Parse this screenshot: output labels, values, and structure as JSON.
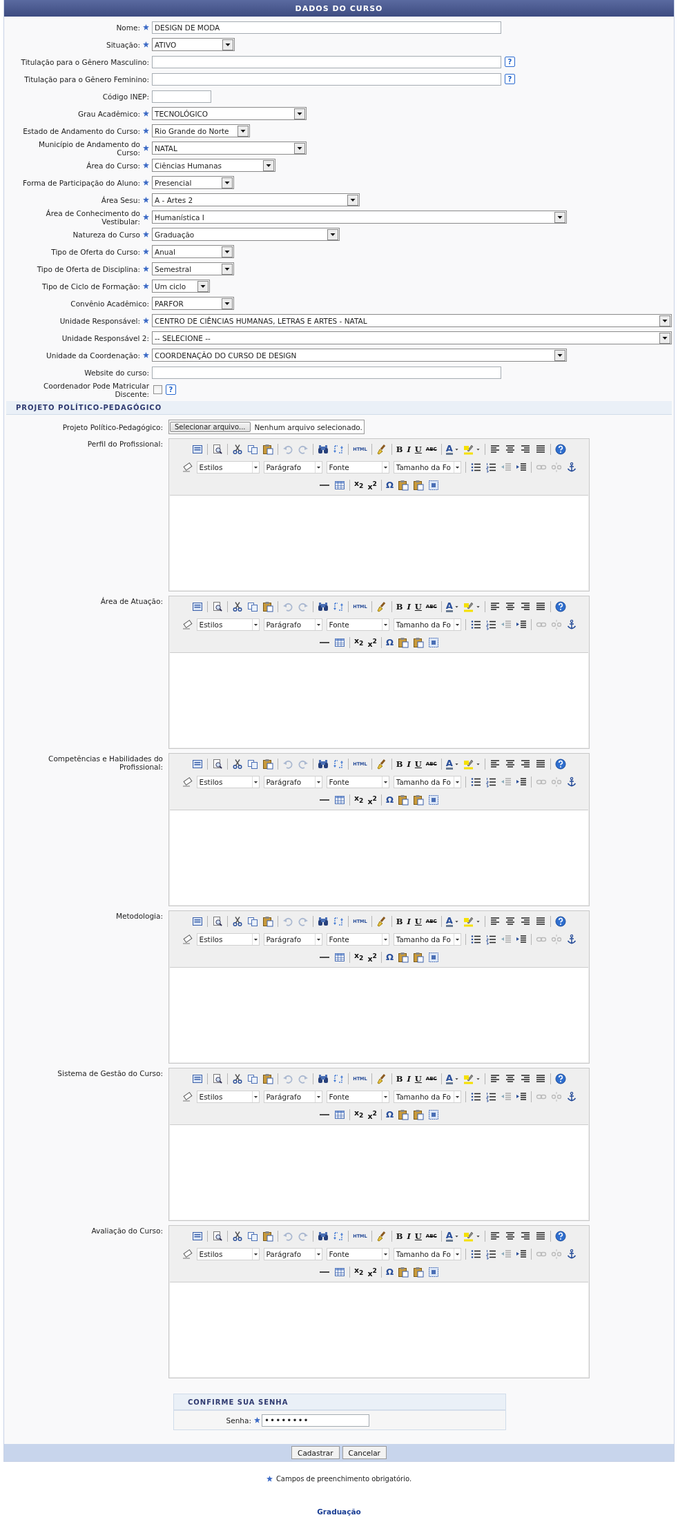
{
  "title": "DADOS DO CURSO",
  "fields": [
    {
      "label": "Nome:",
      "required": true,
      "kind": "text",
      "value": "DESIGN DE MODA"
    },
    {
      "label": "Situação:",
      "required": true,
      "kind": "select",
      "value": "ATIVO"
    },
    {
      "label": "Titulação para o Gênero Masculino:",
      "required": false,
      "kind": "text",
      "help": "?"
    },
    {
      "label": "Titulação para o Gênero Feminino:",
      "required": false,
      "kind": "text",
      "help": "?"
    },
    {
      "label": "Código INEP:",
      "required": false,
      "kind": "text"
    },
    {
      "label": "Grau Acadêmico:",
      "required": true,
      "kind": "select",
      "value": "TECNOLÓGICO"
    },
    {
      "label": "Estado de Andamento do Curso:",
      "required": true,
      "kind": "select",
      "value": "Rio Grande do Norte"
    },
    {
      "label": "Município de Andamento do Curso:",
      "required": true,
      "kind": "select",
      "value": "NATAL"
    },
    {
      "label": "Área do Curso:",
      "required": true,
      "kind": "select",
      "value": "Ciências Humanas"
    },
    {
      "label": "Forma de Participação do Aluno:",
      "required": true,
      "kind": "select",
      "value": "Presencial"
    },
    {
      "label": "Área Sesu:",
      "required": true,
      "kind": "select",
      "value": "A - Artes 2"
    },
    {
      "label": "Área de Conhecimento do Vestibular:",
      "required": true,
      "kind": "select",
      "value": "Humanística I"
    },
    {
      "label": "Natureza do Curso",
      "required": true,
      "kind": "select",
      "value": "Graduação"
    },
    {
      "label": "Tipo de Oferta do Curso:",
      "required": true,
      "kind": "select",
      "value": "Anual"
    },
    {
      "label": "Tipo de Oferta de Disciplina:",
      "required": true,
      "kind": "select",
      "value": "Semestral"
    },
    {
      "label": "Tipo de Ciclo de Formação:",
      "required": true,
      "kind": "select",
      "value": "Um ciclo"
    },
    {
      "label": "Convênio Acadêmico:",
      "required": false,
      "kind": "select",
      "value": "PARFOR"
    },
    {
      "label": "Unidade Responsável:",
      "required": true,
      "kind": "select",
      "value": "CENTRO DE CIÊNCIAS HUMANAS, LETRAS E ARTES - NATAL"
    },
    {
      "label": "Unidade Responsável 2:",
      "required": false,
      "kind": "select",
      "value": "-- SELECIONE --"
    },
    {
      "label": "Unidade da Coordenação:",
      "required": true,
      "kind": "select",
      "value": "COORDENAÇÃO DO CURSO DE DESIGN"
    },
    {
      "label": "Website do curso:",
      "required": false,
      "kind": "text"
    },
    {
      "label": "Coordenador Pode Matricular Discente:",
      "required": false,
      "kind": "checkbox",
      "checked": false,
      "help": "?"
    }
  ],
  "section": "PROJETO POLÍTICO-PEDAGÓGICO",
  "file_field": {
    "label": "Projeto Político-Pedagógico:",
    "button": "Selecionar arquivo...",
    "status": "Nenhum arquivo selecionado."
  },
  "editors": [
    {
      "label": "Perfil do Profissional:",
      "combos": [
        "Estilos",
        "Parágrafo",
        "Fonte",
        "Tamanho da Fo"
      ],
      "text_buttons": [
        "HTML",
        "B",
        "I",
        "U",
        "ABC",
        "A",
        "x$_{2}$",
        "x$^{2}$",
        "Ω"
      ]
    },
    {
      "label": "Área de Atuação:",
      "combos": [
        "Estilos",
        "Parágrafo",
        "Fonte",
        "Tamanho da Fo"
      ],
      "text_buttons": [
        "HTML",
        "B",
        "I",
        "U",
        "ABC",
        "A",
        "x$_{2}$",
        "x$^{2}$",
        "Ω"
      ]
    },
    {
      "label": "Competências e Habilidades do Profissional:",
      "combos": [
        "Estilos",
        "Parágrafo",
        "Fonte",
        "Tamanho da Fo"
      ],
      "text_buttons": [
        "HTML",
        "B",
        "I",
        "U",
        "ABC",
        "A",
        "x$_{2}$",
        "x$^{2}$",
        "Ω"
      ]
    },
    {
      "label": "Metodologia:",
      "combos": [
        "Estilos",
        "Parágrafo",
        "Fonte",
        "Tamanho da Fo"
      ],
      "text_buttons": [
        "HTML",
        "B",
        "I",
        "U",
        "ABC",
        "A",
        "x$_{2}$",
        "x$^{2}$",
        "Ω"
      ]
    },
    {
      "label": "Sistema de Gestão do Curso:",
      "combos": [
        "Estilos",
        "Parágrafo",
        "Fonte",
        "Tamanho da Fo"
      ],
      "text_buttons": [
        "HTML",
        "B",
        "I",
        "U",
        "ABC",
        "A",
        "x$_{2}$",
        "x$^{2}$",
        "Ω"
      ]
    },
    {
      "label": "Avaliação do Curso:",
      "combos": [
        "Estilos",
        "Parágrafo",
        "Fonte",
        "Tamanho da Fo"
      ],
      "text_buttons": [
        "HTML",
        "B",
        "I",
        "U",
        "ABC",
        "A",
        "x$_{2}$",
        "x$^{2}$",
        "Ω"
      ]
    }
  ],
  "password": {
    "title": "CONFIRME SUA SENHA",
    "label": "Senha:",
    "required": true,
    "value": "••••••••"
  },
  "buttons": [
    "Cadastrar",
    "Cancelar"
  ],
  "required_note": "Campos de preenchimento obrigatório.",
  "footer_link": "Graduação"
}
